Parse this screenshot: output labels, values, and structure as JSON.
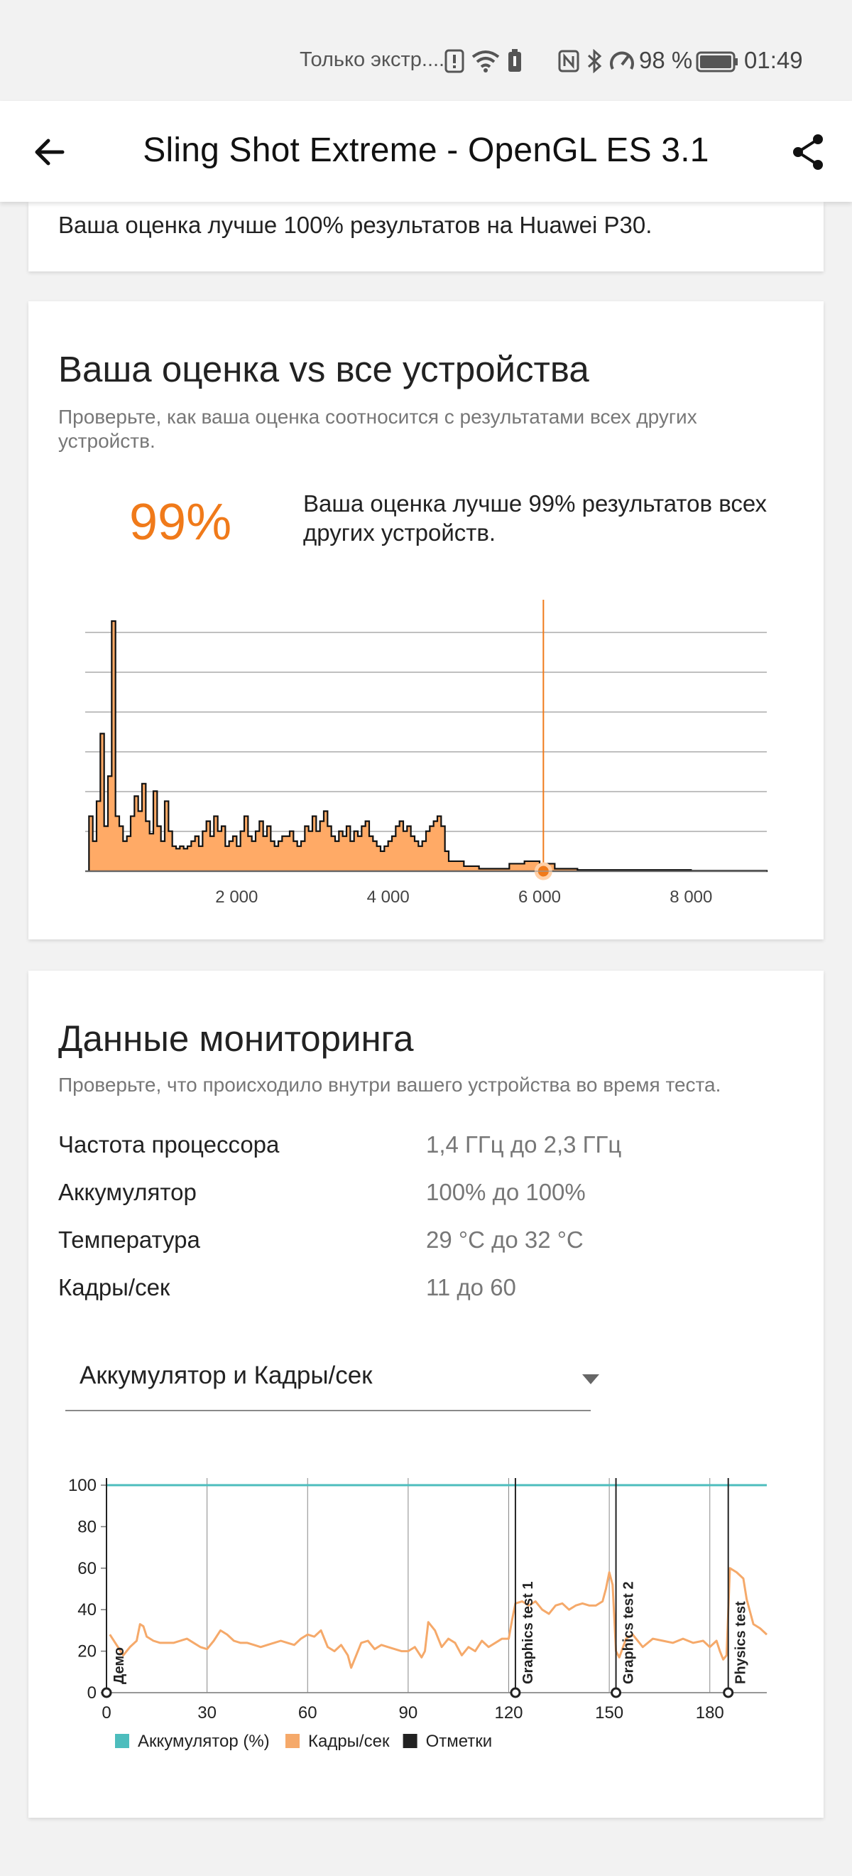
{
  "status_bar": {
    "carrier_text": "Только экстр....",
    "battery_percent": "98 %",
    "time": "01:49",
    "icons": [
      "alert-icon",
      "wifi-icon",
      "battery-saver-icon",
      "nfc-icon",
      "bluetooth-icon",
      "speed-icon",
      "battery-icon"
    ]
  },
  "app_bar": {
    "title": "Sling Shot Extreme - OpenGL ES 3.1",
    "back_icon": "arrow-left",
    "share_icon": "share"
  },
  "top_card": {
    "text": "Ваша оценка лучше 100% результатов на Huawei P30."
  },
  "comparison_card": {
    "title": "Ваша оценка vs все устройства",
    "subtitle": "Проверьте, как ваша оценка соотносится с результатами всех других устройств.",
    "percent": "99%",
    "description": "Ваша оценка лучше 99% результатов всех других устройств.",
    "accent_color": "#f07a1a"
  },
  "monitoring_card": {
    "title": "Данные мониторинга",
    "subtitle": "Проверьте, что происходило внутри вашего устройства во время теста.",
    "rows": [
      {
        "label": "Частота процессора",
        "value": "1,4 ГГц до 2,3 ГГц"
      },
      {
        "label": "Аккумулятор",
        "value": "100% до 100%"
      },
      {
        "label": "Температура",
        "value": "29 °C до 32 °C"
      },
      {
        "label": "Кадры/сек",
        "value": "11 до 60"
      }
    ],
    "dropdown_selected": "Аккумулятор и Кадры/сек"
  },
  "chart_data": [
    {
      "type": "area",
      "x_ticks": [
        "2 000",
        "4 000",
        "6 000",
        "8 000"
      ],
      "xlim": [
        0,
        9000
      ],
      "grid": true,
      "color": "#ffaa66",
      "marker_color": "#f07a1a",
      "your_score": 6050,
      "x": [
        0,
        50,
        100,
        150,
        200,
        250,
        300,
        350,
        400,
        450,
        500,
        550,
        600,
        650,
        700,
        750,
        800,
        850,
        900,
        950,
        1000,
        1050,
        1100,
        1150,
        1200,
        1250,
        1300,
        1350,
        1400,
        1450,
        1500,
        1550,
        1600,
        1650,
        1700,
        1750,
        1800,
        1850,
        1900,
        1950,
        2000,
        2050,
        2100,
        2150,
        2200,
        2250,
        2300,
        2350,
        2400,
        2450,
        2500,
        2550,
        2600,
        2650,
        2700,
        2750,
        2800,
        2850,
        2900,
        2950,
        3000,
        3050,
        3100,
        3150,
        3200,
        3250,
        3300,
        3350,
        3400,
        3450,
        3500,
        3550,
        3600,
        3650,
        3700,
        3750,
        3800,
        3850,
        3900,
        3950,
        4000,
        4050,
        4100,
        4150,
        4200,
        4250,
        4300,
        4350,
        4400,
        4450,
        4500,
        4550,
        4600,
        4650,
        4700,
        4750,
        4800,
        5000,
        5200,
        5400,
        5600,
        5800,
        6000,
        6200,
        6500,
        7000,
        8000,
        9000
      ],
      "y": [
        0,
        22,
        12,
        28,
        55,
        18,
        38,
        100,
        22,
        18,
        12,
        14,
        22,
        30,
        24,
        35,
        20,
        15,
        32,
        18,
        12,
        28,
        16,
        10,
        9,
        10,
        9,
        10,
        12,
        14,
        10,
        16,
        20,
        14,
        22,
        16,
        18,
        10,
        12,
        14,
        10,
        16,
        22,
        14,
        12,
        16,
        20,
        14,
        18,
        12,
        10,
        12,
        14,
        14,
        16,
        12,
        10,
        12,
        18,
        16,
        22,
        16,
        20,
        24,
        18,
        14,
        12,
        16,
        14,
        18,
        12,
        16,
        14,
        18,
        20,
        14,
        12,
        10,
        8,
        10,
        12,
        14,
        18,
        20,
        16,
        18,
        14,
        12,
        10,
        12,
        16,
        18,
        20,
        22,
        18,
        8,
        4,
        2,
        1,
        1,
        3,
        4,
        3,
        1,
        0.5,
        0.5,
        0.2,
        0
      ]
    },
    {
      "type": "line",
      "x_ticks": [
        "0",
        "30",
        "60",
        "90",
        "120",
        "150",
        "180"
      ],
      "y_ticks": [
        "0",
        "20",
        "40",
        "60",
        "80",
        "100"
      ],
      "xlim": [
        0,
        197
      ],
      "ylim": [
        0,
        100
      ],
      "legend_placement": "bottom",
      "legend": [
        {
          "name": "Аккумулятор (%)",
          "color": "#4dbdbd"
        },
        {
          "name": "Кадры/сек",
          "color": "#f5a96a"
        },
        {
          "name": "Отметки",
          "color": "#222222"
        }
      ],
      "markers": [
        {
          "x": 0,
          "label": "Демо"
        },
        {
          "x": 122,
          "label": "Graphics test 1"
        },
        {
          "x": 152,
          "label": "Graphics test 2"
        },
        {
          "x": 185.5,
          "label": "Physics test"
        }
      ],
      "series": [
        {
          "name": "Аккумулятор (%)",
          "color": "#4dbdbd",
          "x": [
            0,
            197
          ],
          "y": [
            100,
            100
          ]
        },
        {
          "name": "Кадры/сек",
          "color": "#f5a96a",
          "x": [
            1,
            3,
            5,
            7,
            9,
            10,
            11,
            12,
            14,
            16,
            18,
            20,
            22,
            24,
            26,
            28,
            30,
            32,
            34,
            36,
            38,
            40,
            42,
            44,
            46,
            48,
            50,
            52,
            54,
            56,
            58,
            60,
            62,
            64,
            66,
            68,
            70,
            72,
            73,
            74,
            76,
            78,
            80,
            82,
            84,
            86,
            88,
            90,
            92,
            94,
            95,
            96,
            98,
            100,
            102,
            104,
            106,
            108,
            110,
            112,
            114,
            116,
            118,
            120,
            121,
            122,
            124,
            126,
            128,
            130,
            132,
            134,
            136,
            138,
            140,
            142,
            144,
            146,
            148,
            149,
            150,
            151,
            152,
            153,
            155,
            157,
            160,
            163,
            166,
            169,
            172,
            175,
            178,
            180,
            182,
            183,
            184,
            185,
            186,
            188,
            190,
            191,
            193,
            195,
            197
          ],
          "y": [
            28,
            23,
            18,
            22,
            25,
            33,
            32,
            27,
            25,
            24,
            24,
            24,
            25,
            26,
            24,
            22,
            21,
            25,
            30,
            28,
            25,
            24,
            24,
            23,
            22,
            23,
            24,
            25,
            24,
            23,
            26,
            28,
            27,
            30,
            22,
            20,
            23,
            18,
            12,
            16,
            24,
            25,
            21,
            23,
            22,
            21,
            20,
            20,
            22,
            17,
            20,
            34,
            30,
            22,
            26,
            24,
            18,
            22,
            20,
            25,
            22,
            24,
            26,
            26,
            35,
            43,
            44,
            42,
            44,
            40,
            38,
            42,
            43,
            40,
            42,
            43,
            42,
            42,
            44,
            50,
            58,
            52,
            20,
            17,
            26,
            28,
            22,
            26,
            25,
            24,
            26,
            24,
            25,
            22,
            25,
            20,
            16,
            18,
            60,
            58,
            55,
            45,
            33,
            31,
            28
          ]
        }
      ]
    }
  ]
}
